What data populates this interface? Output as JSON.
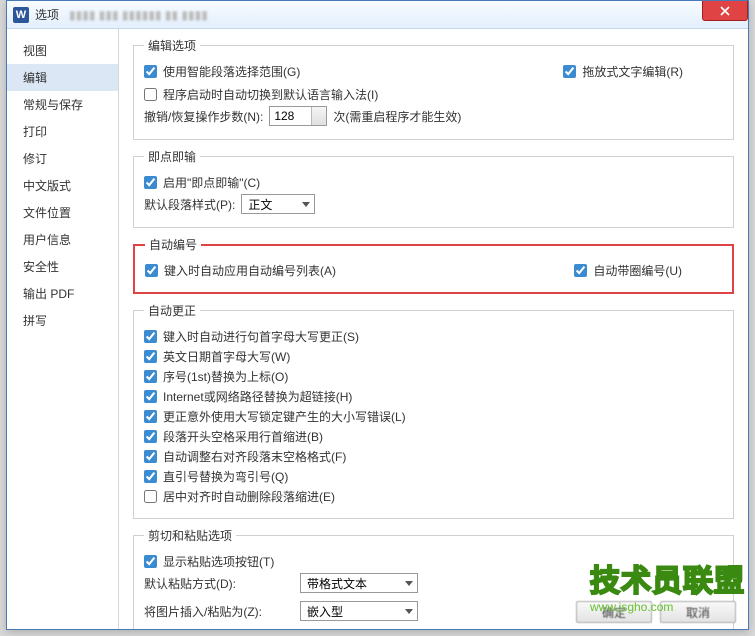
{
  "window": {
    "app_icon": "W",
    "title": "选项"
  },
  "sidebar": {
    "items": [
      {
        "label": "视图"
      },
      {
        "label": "编辑"
      },
      {
        "label": "常规与保存"
      },
      {
        "label": "打印"
      },
      {
        "label": "修订"
      },
      {
        "label": "中文版式"
      },
      {
        "label": "文件位置"
      },
      {
        "label": "用户信息"
      },
      {
        "label": "安全性"
      },
      {
        "label": "输出 PDF"
      },
      {
        "label": "拼写"
      }
    ],
    "selected_index": 1
  },
  "sections": {
    "edit_options": {
      "legend": "编辑选项",
      "smart_select": {
        "label": "使用智能段落选择范围(G)",
        "checked": true
      },
      "drag_text": {
        "label": "拖放式文字编辑(R)",
        "checked": true
      },
      "auto_switch_ime": {
        "label": "程序启动时自动切换到默认语言输入法(I)",
        "checked": false
      },
      "undo_label": "撤销/恢复操作步数(N):",
      "undo_value": "128",
      "undo_hint": "次(需重启程序才能生效)"
    },
    "click_type": {
      "legend": "即点即输",
      "enable": {
        "label": "启用\"即点即输\"(C)",
        "checked": true
      },
      "style_label": "默认段落样式(P):",
      "style_value": "正文"
    },
    "auto_number": {
      "legend": "自动编号",
      "apply_list": {
        "label": "键入时自动应用自动编号列表(A)",
        "checked": true
      },
      "circle_number": {
        "label": "自动带圈编号(U)",
        "checked": true
      }
    },
    "auto_correct": {
      "legend": "自动更正",
      "items": [
        {
          "label": "键入时自动进行句首字母大写更正(S)",
          "checked": true
        },
        {
          "label": "英文日期首字母大写(W)",
          "checked": true
        },
        {
          "label": "序号(1st)替换为上标(O)",
          "checked": true
        },
        {
          "label": "Internet或网络路径替换为超链接(H)",
          "checked": true
        },
        {
          "label": "更正意外使用大写锁定键产生的大小写错误(L)",
          "checked": true
        },
        {
          "label": "段落开头空格采用行首缩进(B)",
          "checked": true
        },
        {
          "label": "自动调整右对齐段落末空格格式(F)",
          "checked": true
        },
        {
          "label": "直引号替换为弯引号(Q)",
          "checked": true
        },
        {
          "label": "居中对齐时自动删除段落缩进(E)",
          "checked": false
        }
      ]
    },
    "cut_paste": {
      "legend": "剪切和粘贴选项",
      "show_button": {
        "label": "显示粘贴选项按钮(T)",
        "checked": true
      },
      "paste_mode_label": "默认粘贴方式(D):",
      "paste_mode_value": "带格式文本",
      "image_paste_label": "将图片插入/粘贴为(Z):",
      "image_paste_value": "嵌入型"
    }
  },
  "buttons": {
    "ok": "确定",
    "cancel": "取消"
  },
  "watermark": {
    "main": "技术员联盟",
    "sub": "www.jsgho.com"
  }
}
